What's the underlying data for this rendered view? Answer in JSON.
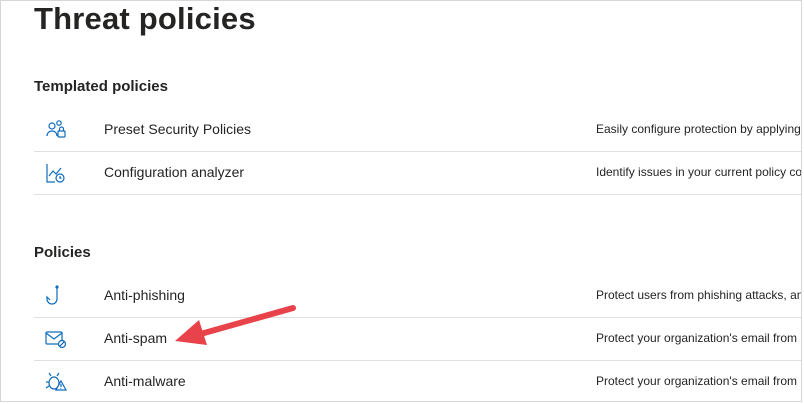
{
  "page": {
    "title": "Threat policies"
  },
  "templated": {
    "heading": "Templated policies",
    "items": [
      {
        "name": "Preset Security Policies",
        "description": "Easily configure protection by applying",
        "icon": "people-lock-icon"
      },
      {
        "name": "Configuration analyzer",
        "description": "Identify issues in your current policy co",
        "icon": "chart-clock-icon"
      }
    ]
  },
  "policies": {
    "heading": "Policies",
    "items": [
      {
        "name": "Anti-phishing",
        "description": "Protect users from phishing attacks, and",
        "icon": "fishhook-icon"
      },
      {
        "name": "Anti-spam",
        "description": "Protect your organization's email from",
        "icon": "mail-block-icon"
      },
      {
        "name": "Anti-malware",
        "description": "Protect your organization's email from",
        "icon": "bug-warning-icon"
      }
    ]
  },
  "colors": {
    "icon": "#0f6cbd",
    "arrow": "#e8424a",
    "divider": "#e1dfdd"
  }
}
